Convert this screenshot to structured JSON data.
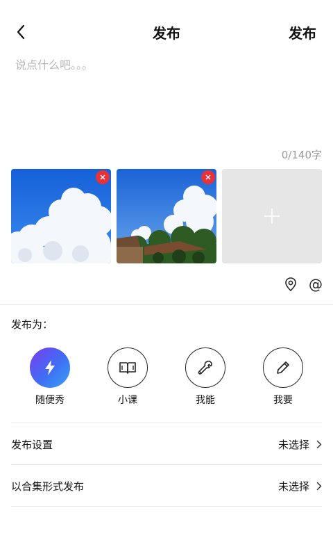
{
  "header": {
    "title": "发布",
    "publish_label": "发布",
    "back_icon": "back-arrow-icon"
  },
  "editor": {
    "placeholder": "说点什么吧。。。",
    "value": "",
    "counter": "0/140字"
  },
  "photos": {
    "items": [
      {
        "name": "photo-1",
        "subject": "sky with clouds"
      },
      {
        "name": "photo-2",
        "subject": "sky with clouds over trees and roof"
      }
    ],
    "add_icon": "plus-icon",
    "remove_icon": "close-icon",
    "remove_color": "#e8323a"
  },
  "tools": {
    "location_icon": "location-pin-icon",
    "mention_symbol": "@"
  },
  "publish_as": {
    "label": "发布为：",
    "options": [
      {
        "label": "随便秀",
        "icon": "lightning-icon",
        "selected": true
      },
      {
        "label": "小课",
        "icon": "book-icon",
        "selected": false
      },
      {
        "label": "我能",
        "icon": "wrench-icon",
        "selected": false
      },
      {
        "label": "我要",
        "icon": "pencil-icon",
        "selected": false
      }
    ]
  },
  "settings": [
    {
      "label": "发布设置",
      "value": "未选择"
    },
    {
      "label": "以合集形式发布",
      "value": "未选择"
    }
  ],
  "colors": {
    "accent_gradient_start": "#7a3cf0",
    "accent_gradient_end": "#38a4f8",
    "divider": "#e6e6e6"
  }
}
